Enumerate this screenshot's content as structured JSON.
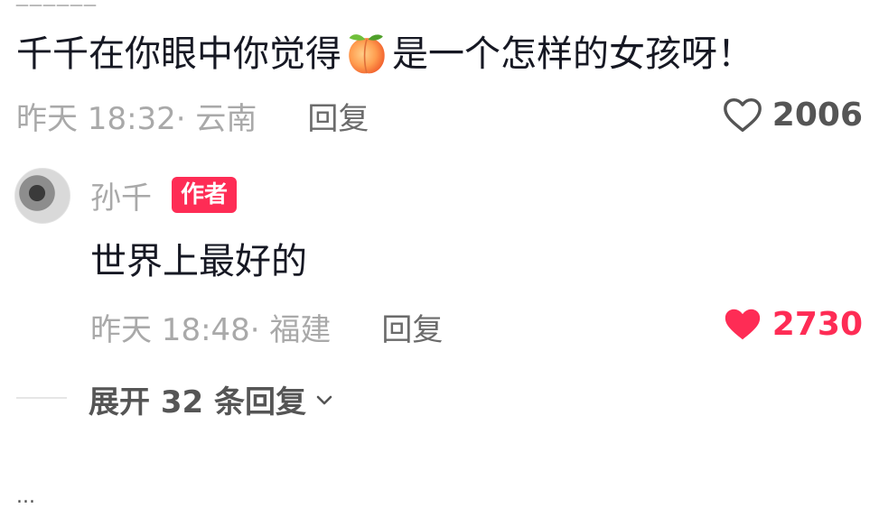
{
  "top_cut_text": "______",
  "comment": {
    "text_before": "千千在你眼中你觉得",
    "emoji": "peach-emoji",
    "text_after": "是一个怎样的女孩呀！",
    "meta": "昨天 18:32· 云南",
    "reply_label": "回复",
    "likes": "2006",
    "liked": false
  },
  "reply": {
    "author": "孙千",
    "badge": "作者",
    "text": "世界上最好的",
    "meta": "昨天 18:48· 福建",
    "reply_label": "回复",
    "likes": "2730",
    "liked": true
  },
  "expand": {
    "label": "展开 32 条回复"
  },
  "bottom_cut_text": "...",
  "colors": {
    "accent": "#fe2c55",
    "meta_gray": "#a9a9a9",
    "text": "#161823"
  }
}
